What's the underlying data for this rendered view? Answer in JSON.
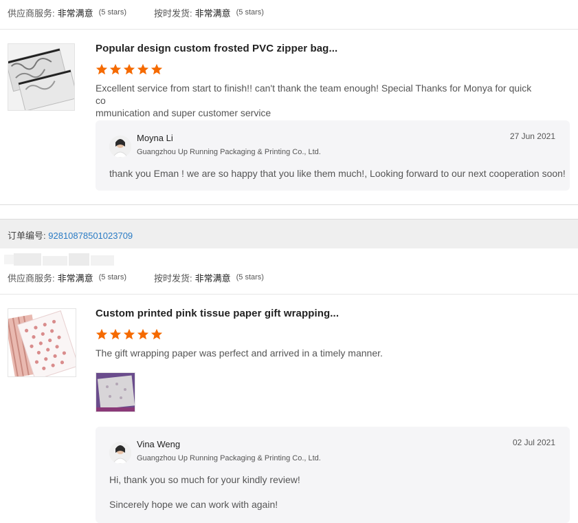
{
  "reviews": [
    {
      "ratings": {
        "supplier_service_label": "供应商服务:",
        "supplier_service_value": "非常满意",
        "supplier_service_stars": "(5 stars)",
        "ontime_label": "按时发货:",
        "ontime_value": "非常满意",
        "ontime_stars": "(5 stars)"
      },
      "product_title": "Popular design custom frosted PVC zipper bag...",
      "rating": 5,
      "review_line1": "Excellent service from start to finish!! can't thank the team enough!  Special Thanks for Monya for quick co",
      "review_line2": "mmunication and super customer service",
      "reply": {
        "name": "Moyna Li",
        "company": "Guangzhou Up Running Packaging & Printing Co., Ltd.",
        "date": "27 Jun 2021",
        "message_line1": "thank you Eman ! we are so happy that you like them much!, Looking forward to our next cooperation soon!",
        "message_line2": ""
      }
    },
    {
      "ratings": {
        "supplier_service_label": "供应商服务:",
        "supplier_service_value": "非常满意",
        "supplier_service_stars": "(5 stars)",
        "ontime_label": "按时发货:",
        "ontime_value": "非常满意",
        "ontime_stars": "(5 stars)"
      },
      "product_title": "Custom printed pink tissue paper gift wrapping...",
      "rating": 5,
      "review_line1": "The gift wrapping paper was perfect and arrived in a timely manner.",
      "review_line2": "",
      "reply": {
        "name": "Vina Weng",
        "company": "Guangzhou Up Running Packaging & Printing Co., Ltd.",
        "date": "02 Jul 2021",
        "message_line1": "Hi, thank you so much for your kindly review!",
        "message_line2": "Sincerely hope we can work with again!"
      }
    }
  ],
  "order": {
    "label": "订单编号:",
    "number": "92810878501023709"
  },
  "colors": {
    "star": "#f56a00",
    "link": "#2a7bc4",
    "reply_bg": "#f5f5f7"
  }
}
